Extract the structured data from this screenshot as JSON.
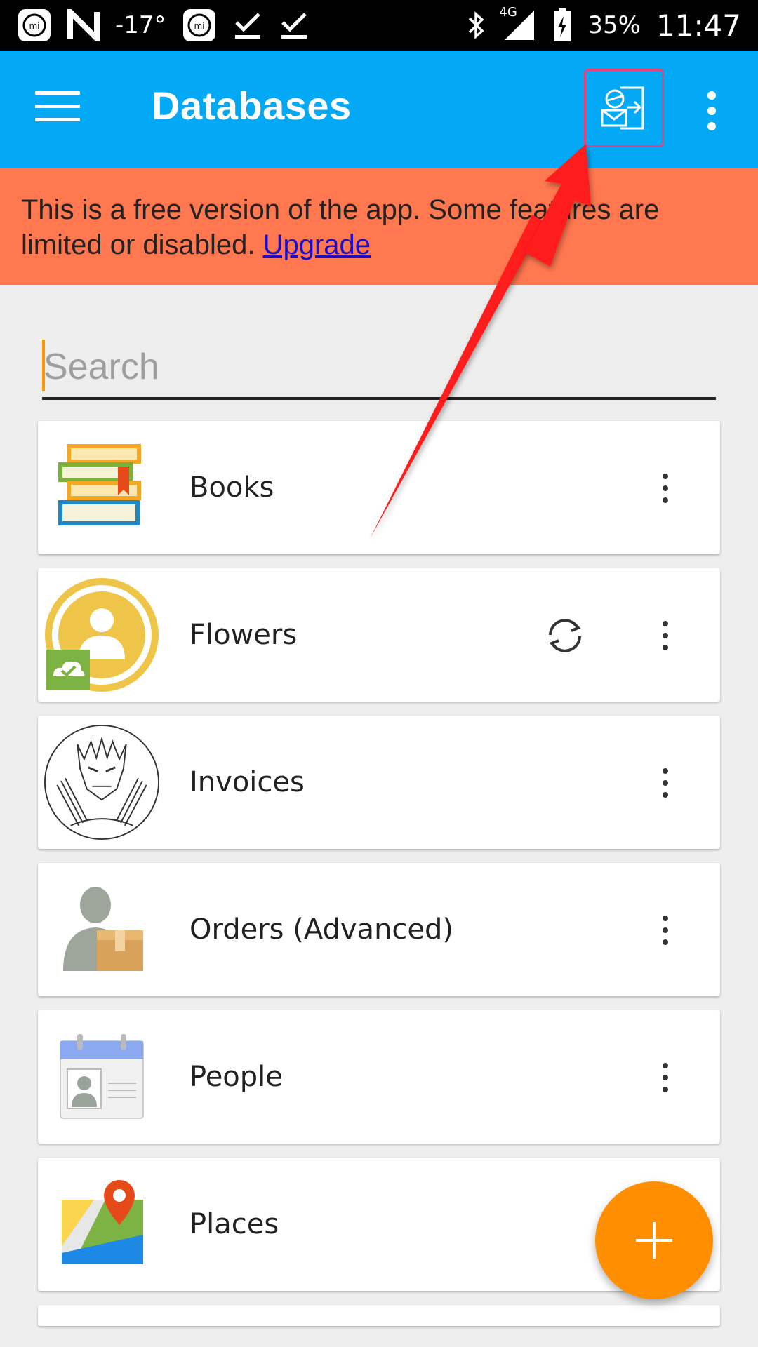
{
  "status_bar": {
    "temperature": "-17°",
    "network": "4G",
    "battery": "35%",
    "time": "11:47"
  },
  "app_bar": {
    "title": "Databases",
    "menu_icon": "hamburger-menu-icon",
    "action_icon": "sync-email-icon",
    "overflow_icon": "more-vert-icon"
  },
  "banner": {
    "text": "This is a free version of the app. Some features are limited or disabled.",
    "link_label": "Upgrade"
  },
  "search": {
    "placeholder": "Search",
    "value": ""
  },
  "databases": [
    {
      "name": "Books",
      "icon": "books-icon"
    },
    {
      "name": "Flowers",
      "icon": "person-cloud-icon",
      "sync_icon": "sync-icon"
    },
    {
      "name": "Invoices",
      "icon": "wolverine-sketch-icon"
    },
    {
      "name": "Orders (Advanced)",
      "icon": "person-box-icon"
    },
    {
      "name": "People",
      "icon": "contact-card-icon"
    },
    {
      "name": "Places",
      "icon": "map-pin-icon"
    }
  ],
  "fab": {
    "icon": "plus-icon"
  },
  "colors": {
    "app_bar": "#03a9f4",
    "banner": "#ff7850",
    "fab": "#ff8f00",
    "highlight": "#e0457b",
    "arrow": "#ff1a1a"
  }
}
